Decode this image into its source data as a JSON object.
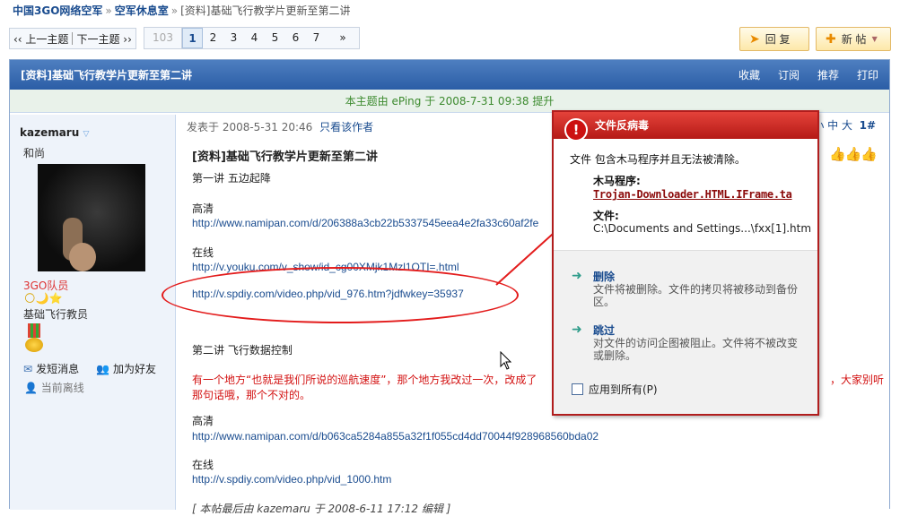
{
  "breadcrumb": {
    "site": "中国3GO网络空军",
    "forum": "空军休息室",
    "current": "[资料]基础飞行教学片更新至第二讲"
  },
  "topic_nav": {
    "prev": "上一主题",
    "next": "下一主题"
  },
  "pager": {
    "total": "103",
    "pages": [
      "1",
      "2",
      "3",
      "4",
      "5",
      "6",
      "7"
    ],
    "current": "1",
    "next": "»"
  },
  "buttons": {
    "reply": "回 复",
    "new_post": "新 帖"
  },
  "thread": {
    "title": "[资料]基础飞行教学片更新至第二讲",
    "actions": [
      "收藏",
      "订阅",
      "推荐",
      "打印"
    ],
    "notice": "本主题由 ePing 于 2008-7-31 09:38 提升"
  },
  "user": {
    "name": "kazemaru",
    "title": "和尚",
    "group": "3GO队员",
    "rank": "基础飞行教员",
    "send_pm": "发短消息",
    "add_friend": "加为好友",
    "status": "当前离线"
  },
  "post": {
    "meta": "发表于 2008-5-31 20:46",
    "only_author": "只看该作者",
    "font_tools": "小 中 大",
    "floor": "1#",
    "title": "[资料]基础飞行教学片更新至第二讲",
    "lines": [
      {
        "text": "第一讲 五边起降",
        "kind": "plain"
      },
      {
        "text": "高清",
        "kind": "plain"
      },
      {
        "text": "http://www.namipan.com/d/206388a3cb22b5337545eea4e2fa33c60af2fe",
        "kind": "link"
      },
      {
        "text": "在线",
        "kind": "plain"
      },
      {
        "text": "http://v.youku.com/v_show/id_cg00XMjk1Mzl1OTI=.html",
        "kind": "link"
      },
      {
        "text": "http://v.spdiy.com/video.php/vid_976.htm?jdfwkey=35937",
        "kind": "link"
      },
      {
        "text": "第二讲 飞行数据控制",
        "kind": "plain"
      },
      {
        "text": "有一个地方“也就是我们所说的巡航速度”，那个地方我改过一次，改成了",
        "kind": "red"
      },
      {
        "text": "，大家别听",
        "kind": "red"
      },
      {
        "text": "那句话哦，那个不对的。",
        "kind": "red"
      },
      {
        "text": "高清",
        "kind": "plain"
      },
      {
        "text": "http://www.namipan.com/d/b063ca5284a855a32f1f055cd4dd70044f928968560bda02",
        "kind": "link"
      },
      {
        "text": "在线",
        "kind": "plain"
      },
      {
        "text": "http://v.spdiy.com/video.php/vid_1000.htm",
        "kind": "link"
      },
      {
        "text": "[ 本帖最后由 kazemaru 于 2008-6-11 17:12 编辑 ]",
        "kind": "plain"
      }
    ]
  },
  "av_dialog": {
    "title": "文件反病毒",
    "message": "文件 包含木马程序并且无法被清除。",
    "trojan_label": "木马程序:",
    "trojan_name": "Trojan-Downloader.HTML.IFrame.ta",
    "file_label": "文件:",
    "file_path": "C:\\Documents and Settings...\\fxx[1].htm",
    "delete_title": "删除",
    "delete_desc": "文件将被删除。文件的拷贝将被移动到备份区。",
    "skip_title": "跳过",
    "skip_desc": "对文件的访问企图被阻止。文件将不被改变或删除。",
    "apply_all": "应用到所有(P)"
  },
  "colors": {
    "accent_blue": "#2b5ea6",
    "alert_red": "#b51a16",
    "annotation_red": "#e31b1b"
  }
}
